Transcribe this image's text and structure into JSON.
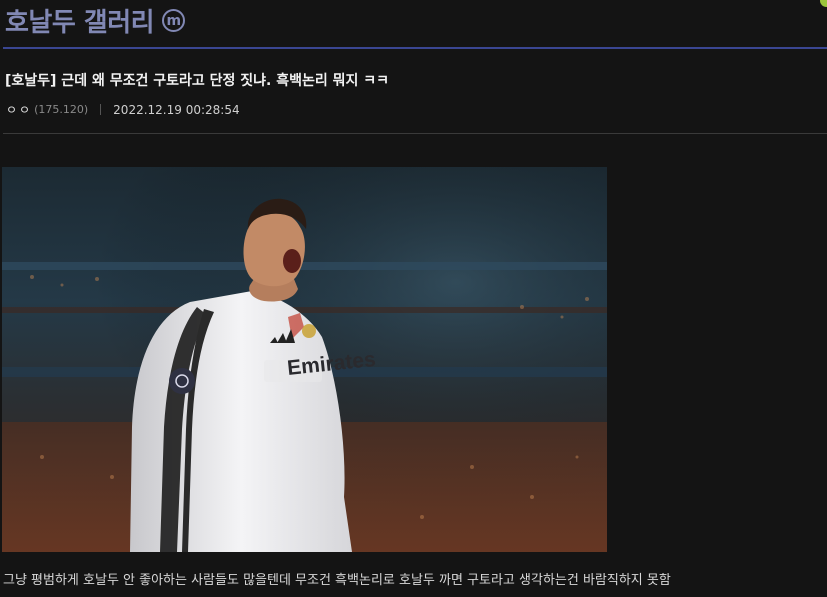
{
  "gallery": {
    "title": "호날두 갤러리",
    "minor_badge": "m",
    "accent_color": "#8188b4",
    "rule_color": "#3a4692"
  },
  "post": {
    "title": "[호날두] 근데 왜 무조건 구토라고 단정 짓냐. 흑백논리 뭐지 ㅋㅋ",
    "author": "ㅇㅇ",
    "author_ip": "(175.120)",
    "date": "2022.12.19 00:28:54",
    "body": "그냥 평범하게 호날두 안 좋아하는 사람들도 많을텐데 무조건 흑백논리로 호날두 까면 구토라고 생각하는건 바람직하지 못함",
    "image": {
      "jersey_text": "Emirates",
      "icons": [
        "minor-gallery-icon",
        "adidas-logo-icon",
        "real-madrid-crest-icon",
        "champions-league-patch-icon"
      ]
    }
  }
}
